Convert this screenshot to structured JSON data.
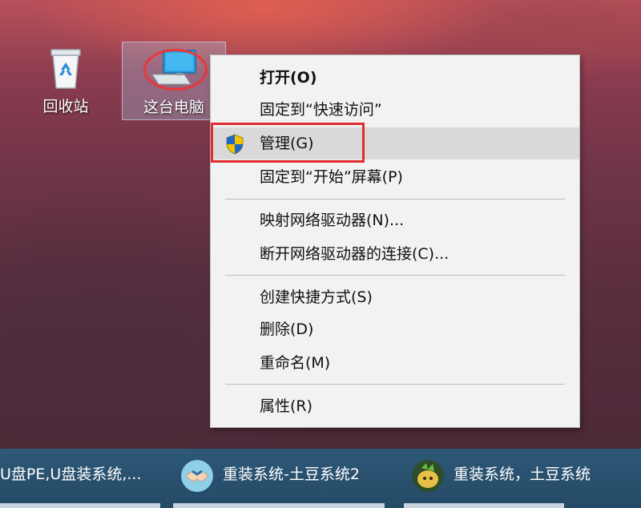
{
  "desktop": {
    "icons": [
      {
        "label": "回收站",
        "icon": "recycle-bin-icon"
      },
      {
        "label": "这台电脑",
        "icon": "computer-icon"
      }
    ]
  },
  "context_menu": {
    "items": [
      {
        "label": "打开(O)",
        "bold": true
      },
      {
        "label": "固定到“快速访问”"
      },
      {
        "label": "管理(G)",
        "icon": "uac-shield-icon",
        "highlighted": true
      },
      {
        "label": "固定到“开始”屏幕(P)"
      },
      {
        "label": "映射网络驱动器(N)..."
      },
      {
        "label": "断开网络驱动器的连接(C)..."
      },
      {
        "label": "创建快捷方式(S)"
      },
      {
        "label": "删除(D)"
      },
      {
        "label": "重命名(M)"
      },
      {
        "label": "属性(R)"
      }
    ]
  },
  "taskbar": {
    "items": [
      {
        "label": "U盘PE,U盘装系统,..."
      },
      {
        "label": "重装系统-土豆系统2",
        "icon": "handshake-icon"
      },
      {
        "label": "重装系统，土豆系统",
        "icon": "potato-logo-icon"
      }
    ]
  },
  "colors": {
    "annotation_red": "#e02c2e",
    "menu_bg": "#f2f2f2",
    "taskbar": "#2a5270"
  }
}
